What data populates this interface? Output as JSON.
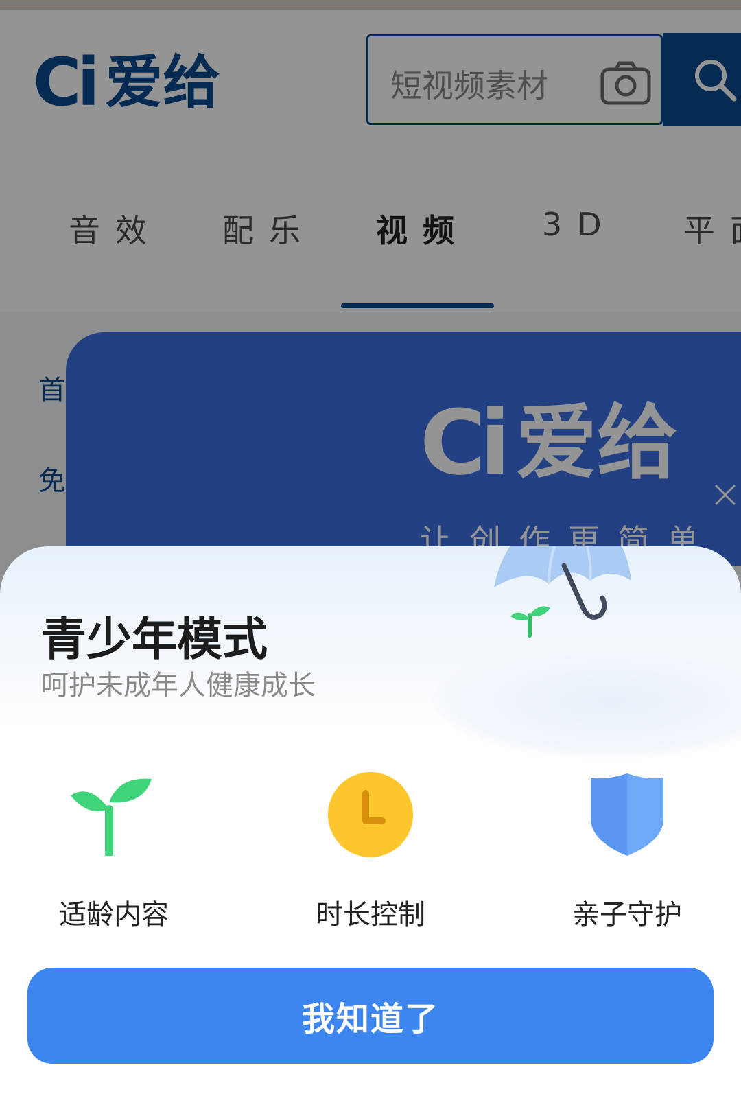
{
  "header": {
    "logo_mark": "Ci",
    "logo_text": "爱给",
    "search": {
      "placeholder": "短视频素材"
    }
  },
  "tabs": [
    {
      "label": "音效"
    },
    {
      "label": "配乐"
    },
    {
      "label": "视频",
      "active": true
    },
    {
      "label": "3D"
    },
    {
      "label": "平面"
    }
  ],
  "side_nav": [
    {
      "label": "首"
    },
    {
      "label": "免"
    }
  ],
  "banner": {
    "logo_mark": "Ci",
    "logo_text": "爱给",
    "slogan": "让创作更简单"
  },
  "modal": {
    "title": "青少年模式",
    "subtitle": "呵护未成年人健康成长",
    "features": [
      {
        "label": "适龄内容",
        "icon": "sprout-icon"
      },
      {
        "label": "时长控制",
        "icon": "clock-icon"
      },
      {
        "label": "亲子守护",
        "icon": "shield-icon"
      }
    ],
    "confirm_label": "我知道了"
  },
  "colors": {
    "brand": "#0b4b8f",
    "banner": "#3b6fe0",
    "button": "#3d86f0",
    "sprout": "#3fd37a",
    "clock": "#fcc62c",
    "shield": "#5a97f2"
  }
}
